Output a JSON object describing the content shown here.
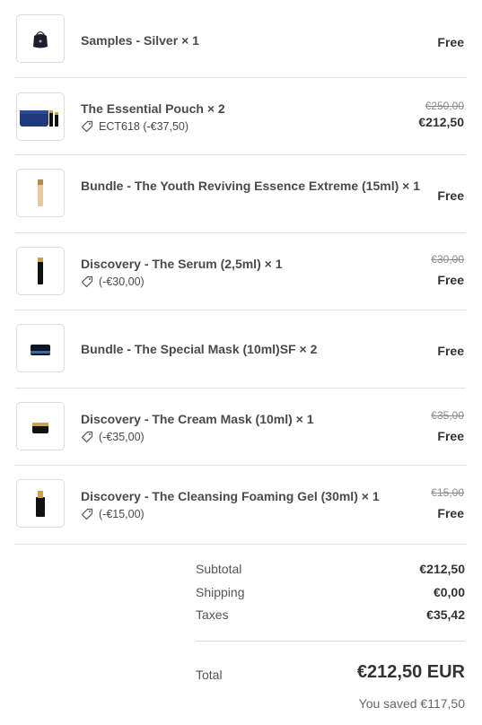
{
  "items": [
    {
      "name": "Samples - Silver",
      "qty_text": "× 1",
      "discount": "",
      "original": "",
      "final": "Free",
      "icon": "pouch-icon"
    },
    {
      "name": "The Essential Pouch",
      "qty_text": "× 2",
      "discount": "ECT618 (-€37,50)",
      "original": "€250,00",
      "final": "€212,50",
      "icon": "kit-icon"
    },
    {
      "name": "Bundle - The Youth Reviving Essence Extreme (15ml)",
      "qty_text": "× 1",
      "discount": "",
      "original": "",
      "final": "Free",
      "icon": "bottle-icon"
    },
    {
      "name": "Discovery - The Serum (2,5ml)",
      "qty_text": "× 1",
      "discount": "(-€30,00)",
      "original": "€30,00",
      "final": "Free",
      "icon": "serum-icon"
    },
    {
      "name": "Bundle - The Special Mask (10ml)SF",
      "qty_text": "× 2",
      "discount": "",
      "original": "",
      "final": "Free",
      "icon": "mask-jar-icon"
    },
    {
      "name": "Discovery - The Cream Mask (10ml)",
      "qty_text": "× 1",
      "discount": "(-€35,00)",
      "original": "€35,00",
      "final": "Free",
      "icon": "cream-jar-icon"
    },
    {
      "name": "Discovery - The Cleansing Foaming Gel (30ml)",
      "qty_text": "× 1",
      "discount": "(-€15,00)",
      "original": "€15,00",
      "final": "Free",
      "icon": "gel-bottle-icon"
    }
  ],
  "summary": {
    "subtotal_label": "Subtotal",
    "subtotal": "€212,50",
    "shipping_label": "Shipping",
    "shipping": "€0,00",
    "taxes_label": "Taxes",
    "taxes": "€35,42",
    "total_label": "Total",
    "total": "€212,50 EUR",
    "saved": "You saved €117,50"
  }
}
